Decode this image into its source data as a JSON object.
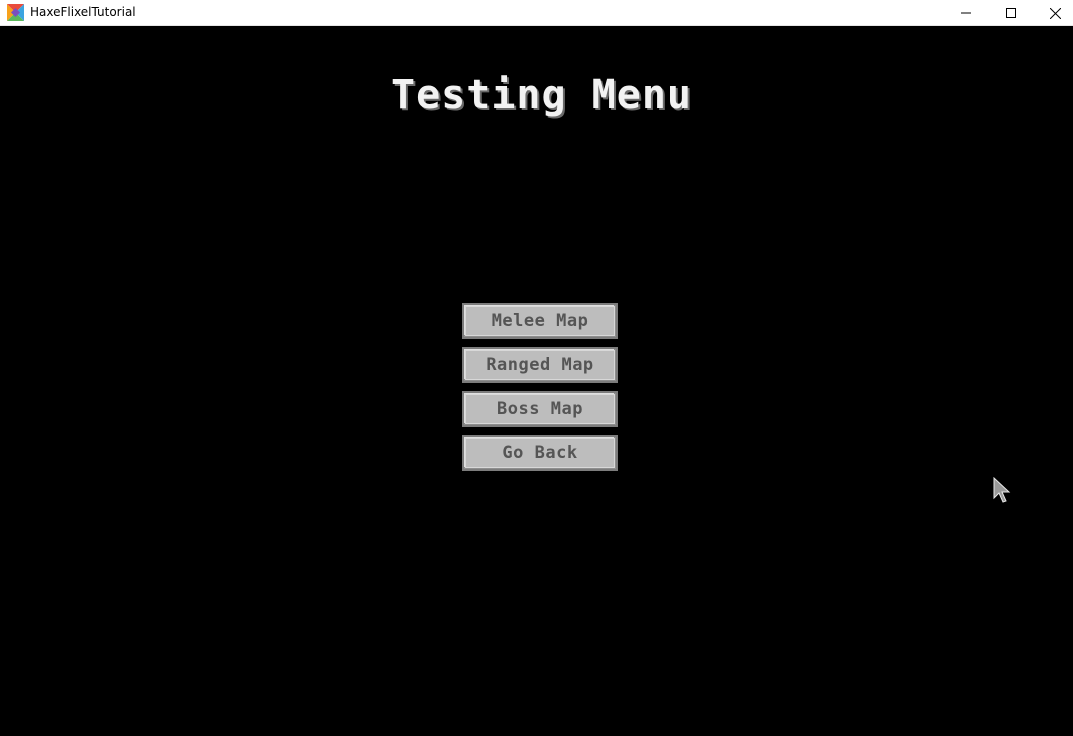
{
  "window": {
    "title": "HaxeFlixelTutorial",
    "controls": {
      "minimize_icon": "minimize-icon",
      "maximize_icon": "maximize-icon",
      "close_icon": "close-icon"
    }
  },
  "menu": {
    "title": "Testing Menu",
    "buttons": [
      {
        "label": "Melee Map"
      },
      {
        "label": "Ranged Map"
      },
      {
        "label": "Boss Map"
      },
      {
        "label": "Go Back"
      }
    ]
  },
  "colors": {
    "background": "#000000",
    "title_text": "#f2f2f2",
    "button_face": "#bdbdbd",
    "button_text": "#555555"
  }
}
